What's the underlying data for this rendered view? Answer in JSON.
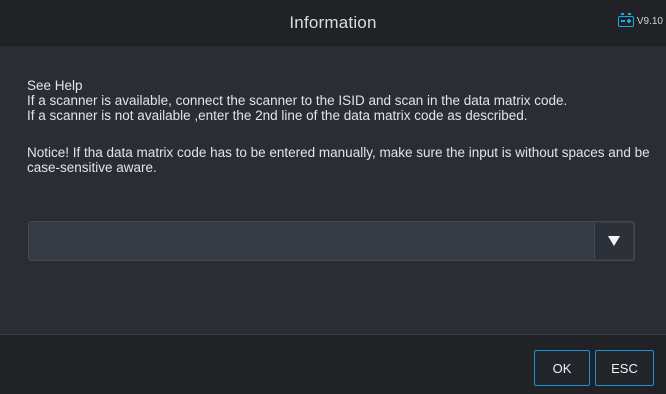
{
  "header": {
    "title": "Information",
    "version": "V9.10",
    "battery_icon": "battery-icon"
  },
  "content": {
    "help_heading": "See Help",
    "help_line1": "If a scanner is available, connect the scanner to the ISID and scan in the data matrix code.",
    "help_line2": "If a scanner is not available ,enter the 2nd line of the data matrix code as described.",
    "notice": "Notice! If tha data matrix code has to be entered manually, make sure the input is without spaces and be case-sensitive aware."
  },
  "select": {
    "value": "",
    "arrow_icon": "triangle-down-icon"
  },
  "footer": {
    "ok_label": "OK",
    "esc_label": "ESC"
  },
  "colors": {
    "background": "#2a2d33",
    "header": "#202226",
    "accent": "#1b8fd8",
    "battery": "#17a9e6"
  }
}
